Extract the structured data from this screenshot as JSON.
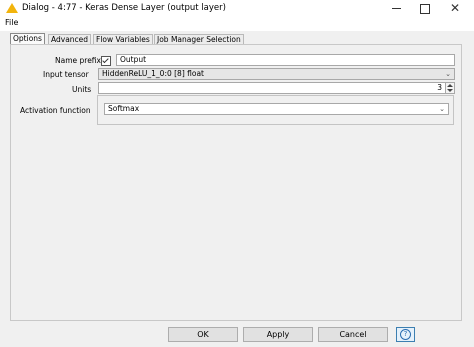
{
  "window": {
    "title": "Dialog - 4:77 - Keras Dense Layer (output layer)",
    "close_glyph": "✕"
  },
  "menu": {
    "file": "File"
  },
  "tabs": [
    {
      "label": "Options",
      "active": true
    },
    {
      "label": "Advanced"
    },
    {
      "label": "Flow Variables"
    },
    {
      "label": "Job Manager Selection"
    }
  ],
  "form": {
    "name_prefix_label": "Name prefix",
    "name_prefix_checked": true,
    "name_prefix_value": "Output",
    "input_tensor_label": "Input tensor",
    "input_tensor_value": "HiddenReLU_1_0:0 [8] float",
    "units_label": "Units",
    "units_value": "3",
    "activation_label": "Activation function",
    "activation_value": "Softmax"
  },
  "buttons": {
    "ok": "OK",
    "apply": "Apply",
    "cancel": "Cancel",
    "help_glyph": "?"
  },
  "colors": {
    "warning_icon": "#f2b40c",
    "dialog_bg": "#f0f0f0"
  }
}
